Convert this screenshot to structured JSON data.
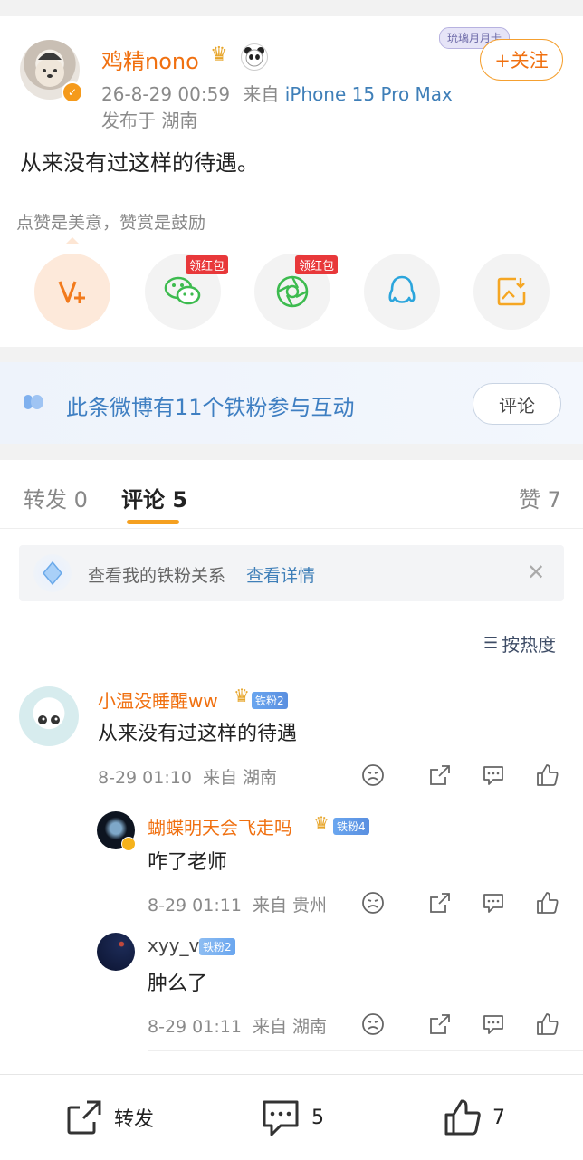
{
  "post": {
    "username": "鸡精nono",
    "timestamp": "26-8-29 00:59",
    "source_prefix": "来自",
    "device": "iPhone 15 Pro Max",
    "location": "发布于 湖南",
    "follow_label": "+关注",
    "badge_ribbon": "琉璃月月卡",
    "content": "从来没有过这样的待遇。",
    "reward_hint": "点赞是美意，赞赏是鼓励"
  },
  "share_options": [
    {
      "name": "reward",
      "icon": "reward-v-icon",
      "tag": ""
    },
    {
      "name": "wechat",
      "icon": "wechat-icon",
      "tag": "领红包"
    },
    {
      "name": "moments",
      "icon": "moments-icon",
      "tag": "领红包"
    },
    {
      "name": "qq",
      "icon": "qq-icon",
      "tag": ""
    },
    {
      "name": "save-image",
      "icon": "save-image-icon",
      "tag": ""
    }
  ],
  "fan_banner": {
    "text": "此条微博有11个铁粉参与互动",
    "button": "评论"
  },
  "tabs": {
    "repost": "转发 0",
    "comments": "评论 5",
    "likes": "赞 7"
  },
  "fan_relation": {
    "text": "查看我的铁粉关系",
    "link": "查看详情"
  },
  "sort": {
    "label": "按热度"
  },
  "comments": [
    {
      "username": "小温没睡醒ww",
      "fan_badge": "铁粉2",
      "text": "从来没有过这样的待遇",
      "meta": "8-29 01:10  来自 湖南",
      "replies": [
        {
          "username": "蝴蝶明天会飞走吗",
          "fan_badge": "铁粉4",
          "text": "咋了老师",
          "meta": "8-29 01:11  来自 贵州"
        },
        {
          "username": "xyy_v",
          "fan_badge": "铁粉2",
          "text": "肿么了",
          "meta": "8-29 01:11  来自 湖南"
        }
      ]
    }
  ],
  "bottom_bar": {
    "repost": "转发",
    "comments": "5",
    "likes": "7"
  },
  "colors": {
    "accent_orange": "#f07010",
    "link_blue": "#3f7fb8",
    "underline": "#f5a020"
  }
}
